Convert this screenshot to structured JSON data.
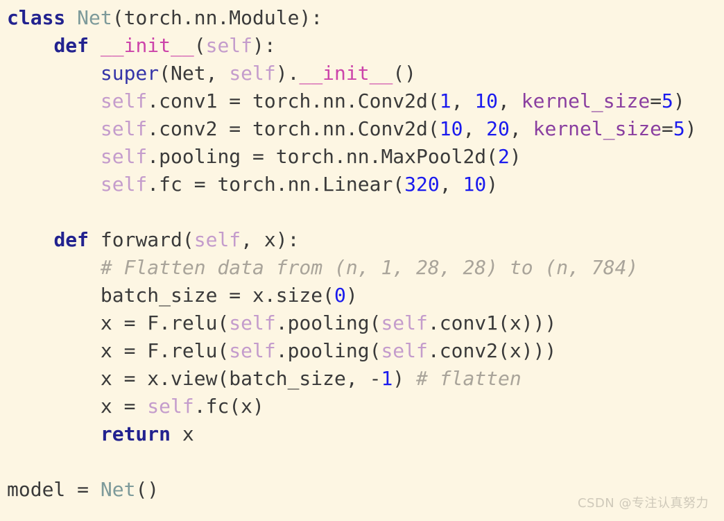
{
  "editor": {
    "background_color": "#fdf6e3",
    "language": "python",
    "font_size_px": 28,
    "line_height_px": 40
  },
  "palette": {
    "keyword": "#22228f",
    "class_name": "#7d9a9a",
    "builtin": "#3434a8",
    "dunder": "#cc44aa",
    "self": "#c49ccc",
    "number": "#1a1aee",
    "kwarg": "#8a3fa0",
    "plain": "#3a3a3a",
    "comment": "#a9a49a",
    "watermark": "#cfc9ba"
  },
  "code": {
    "lines": [
      {
        "n": 1,
        "indent": 0,
        "text": "class Net(torch.nn.Module):",
        "tokens": [
          {
            "t": "class",
            "c": "kw"
          },
          {
            "t": " ",
            "c": "plain"
          },
          {
            "t": "Net",
            "c": "cls"
          },
          {
            "t": "(torch.nn.Module):",
            "c": "plain"
          }
        ]
      },
      {
        "n": 2,
        "indent": 1,
        "text": "def __init__(self):",
        "tokens": [
          {
            "t": "def",
            "c": "kw"
          },
          {
            "t": " ",
            "c": "plain"
          },
          {
            "t": "__init__",
            "c": "dunder"
          },
          {
            "t": "(",
            "c": "plain"
          },
          {
            "t": "self",
            "c": "self"
          },
          {
            "t": "):",
            "c": "plain"
          }
        ]
      },
      {
        "n": 3,
        "indent": 2,
        "text": "super(Net, self).__init__()",
        "tokens": [
          {
            "t": "super",
            "c": "builtin"
          },
          {
            "t": "(Net, ",
            "c": "plain"
          },
          {
            "t": "self",
            "c": "self"
          },
          {
            "t": ").",
            "c": "plain"
          },
          {
            "t": "__init__",
            "c": "dunder"
          },
          {
            "t": "()",
            "c": "plain"
          }
        ]
      },
      {
        "n": 4,
        "indent": 2,
        "text": "self.conv1 = torch.nn.Conv2d(1, 10, kernel_size=5)",
        "tokens": [
          {
            "t": "self",
            "c": "self"
          },
          {
            "t": ".conv1 = torch.nn.Conv2d(",
            "c": "plain"
          },
          {
            "t": "1",
            "c": "num"
          },
          {
            "t": ", ",
            "c": "plain"
          },
          {
            "t": "10",
            "c": "num"
          },
          {
            "t": ", ",
            "c": "plain"
          },
          {
            "t": "kernel_size",
            "c": "kwarg"
          },
          {
            "t": "=",
            "c": "plain"
          },
          {
            "t": "5",
            "c": "num"
          },
          {
            "t": ")",
            "c": "plain"
          }
        ]
      },
      {
        "n": 5,
        "indent": 2,
        "text": "self.conv2 = torch.nn.Conv2d(10, 20, kernel_size=5)",
        "tokens": [
          {
            "t": "self",
            "c": "self"
          },
          {
            "t": ".conv2 = torch.nn.Conv2d(",
            "c": "plain"
          },
          {
            "t": "10",
            "c": "num"
          },
          {
            "t": ", ",
            "c": "plain"
          },
          {
            "t": "20",
            "c": "num"
          },
          {
            "t": ", ",
            "c": "plain"
          },
          {
            "t": "kernel_size",
            "c": "kwarg"
          },
          {
            "t": "=",
            "c": "plain"
          },
          {
            "t": "5",
            "c": "num"
          },
          {
            "t": ")",
            "c": "plain"
          }
        ]
      },
      {
        "n": 6,
        "indent": 2,
        "text": "self.pooling = torch.nn.MaxPool2d(2)",
        "tokens": [
          {
            "t": "self",
            "c": "self"
          },
          {
            "t": ".pooling = torch.nn.MaxPool2d(",
            "c": "plain"
          },
          {
            "t": "2",
            "c": "num"
          },
          {
            "t": ")",
            "c": "plain"
          }
        ]
      },
      {
        "n": 7,
        "indent": 2,
        "text": "self.fc = torch.nn.Linear(320, 10)",
        "tokens": [
          {
            "t": "self",
            "c": "self"
          },
          {
            "t": ".fc = torch.nn.Linear(",
            "c": "plain"
          },
          {
            "t": "320",
            "c": "num"
          },
          {
            "t": ", ",
            "c": "plain"
          },
          {
            "t": "10",
            "c": "num"
          },
          {
            "t": ")",
            "c": "plain"
          }
        ]
      },
      {
        "n": 8,
        "indent": 0,
        "text": "",
        "tokens": []
      },
      {
        "n": 9,
        "indent": 1,
        "text": "def forward(self, x):",
        "tokens": [
          {
            "t": "def",
            "c": "kw"
          },
          {
            "t": " forward(",
            "c": "plain"
          },
          {
            "t": "self",
            "c": "self"
          },
          {
            "t": ", x):",
            "c": "plain"
          }
        ]
      },
      {
        "n": 10,
        "indent": 2,
        "text": "# Flatten data from (n, 1, 28, 28) to (n, 784)",
        "tokens": [
          {
            "t": "# Flatten data from (n, 1, 28, 28) to (n, 784)",
            "c": "comment"
          }
        ]
      },
      {
        "n": 11,
        "indent": 2,
        "text": "batch_size = x.size(0)",
        "tokens": [
          {
            "t": "batch_size = x.size(",
            "c": "plain"
          },
          {
            "t": "0",
            "c": "num"
          },
          {
            "t": ")",
            "c": "plain"
          }
        ]
      },
      {
        "n": 12,
        "indent": 2,
        "text": "x = F.relu(self.pooling(self.conv1(x)))",
        "tokens": [
          {
            "t": "x = F.relu(",
            "c": "plain"
          },
          {
            "t": "self",
            "c": "self"
          },
          {
            "t": ".pooling(",
            "c": "plain"
          },
          {
            "t": "self",
            "c": "self"
          },
          {
            "t": ".conv1(x)))",
            "c": "plain"
          }
        ]
      },
      {
        "n": 13,
        "indent": 2,
        "text": "x = F.relu(self.pooling(self.conv2(x)))",
        "tokens": [
          {
            "t": "x = F.relu(",
            "c": "plain"
          },
          {
            "t": "self",
            "c": "self"
          },
          {
            "t": ".pooling(",
            "c": "plain"
          },
          {
            "t": "self",
            "c": "self"
          },
          {
            "t": ".conv2(x)))",
            "c": "plain"
          }
        ]
      },
      {
        "n": 14,
        "indent": 2,
        "text": "x = x.view(batch_size, -1) # flatten",
        "tokens": [
          {
            "t": "x = x.view(batch_size, -",
            "c": "plain"
          },
          {
            "t": "1",
            "c": "num"
          },
          {
            "t": ") ",
            "c": "plain"
          },
          {
            "t": "# flatten",
            "c": "comment"
          }
        ]
      },
      {
        "n": 15,
        "indent": 2,
        "text": "x = self.fc(x)",
        "tokens": [
          {
            "t": "x = ",
            "c": "plain"
          },
          {
            "t": "self",
            "c": "self"
          },
          {
            "t": ".fc(x)",
            "c": "plain"
          }
        ]
      },
      {
        "n": 16,
        "indent": 2,
        "text": "return x",
        "tokens": [
          {
            "t": "return",
            "c": "kw"
          },
          {
            "t": " x",
            "c": "plain"
          }
        ]
      },
      {
        "n": 17,
        "indent": 0,
        "text": "",
        "tokens": []
      },
      {
        "n": 18,
        "indent": 0,
        "text": "model = Net()",
        "tokens": [
          {
            "t": "model = ",
            "c": "plain"
          },
          {
            "t": "Net",
            "c": "cls"
          },
          {
            "t": "()",
            "c": "plain"
          }
        ]
      }
    ]
  },
  "watermark": {
    "text": "CSDN @专注认真努力"
  }
}
